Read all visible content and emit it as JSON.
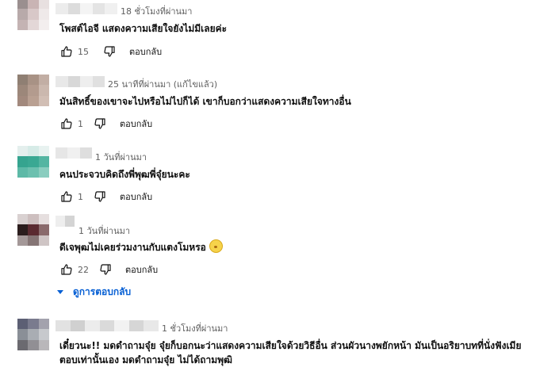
{
  "comments": [
    {
      "time": "18 ชั่วโมงที่ผ่านมา",
      "text": "โพสต์ไอจี แสดงความเสียใจยังไม่มีเลยค่ะ",
      "likes": "15",
      "reply_label": "ตอบกลับ",
      "avatar_colors": [
        "#9a8f8f",
        "#c9b4b4",
        "#e8e0e0",
        "#b8aaaa",
        "#d8c8c8",
        "#efe9e9",
        "#c4b3b3",
        "#e3d7d7",
        "#f3eeee"
      ],
      "name_colors": [
        "#ececec",
        "#dcdcdc",
        "#f4f4f4",
        "#e4e4e4",
        "#f0f0f0"
      ]
    },
    {
      "time": "25 นาทีที่ผ่านมา (แก้ไขแล้ว)",
      "text": "มันสิทธิ์ของเขาจะไปหรือไม่ไปก็ได้ เขาก็บอกว่าแสดงความเสียใจทางอื่น",
      "likes": "1",
      "reply_label": "ตอบกลับ",
      "avatar_colors": [
        "#8f7f73",
        "#a89285",
        "#c2aea4",
        "#9c877a",
        "#b39b8e",
        "#cbb8ae",
        "#a2897d",
        "#b9a092",
        "#d1beb4"
      ],
      "name_colors": [
        "#e8e8e8",
        "#d8d8d8",
        "#eeeeee",
        "#e0e0e0"
      ]
    },
    {
      "time": "1 วันที่ผ่านมา",
      "text": "คนประจวบคิดถึงพี่พุฒพี่จุ๋ยนะคะ",
      "likes": "1",
      "reply_label": "ตอบกลับ",
      "avatar_colors": [
        "#e4efed",
        "#d6ebe7",
        "#e8f2f0",
        "#35a48f",
        "#3aa893",
        "#54b5a2",
        "#5db9a7",
        "#6cc0af",
        "#8acdbf"
      ],
      "name_colors": [
        "#e6e6e6",
        "#f0f0f0",
        "#dedede"
      ]
    },
    {
      "time": "1 วันที่ผ่านมา",
      "text": "ดีเจพุฒไม่เคยร่วมงานกับแตงโมหรอ",
      "likes": "22",
      "reply_label": "ตอบกลับ",
      "avatar_colors": [
        "#d9d1d1",
        "#cdbfbf",
        "#e6dfdf",
        "#2b1d1d",
        "#5a2a30",
        "#8a6a6c",
        "#a49898",
        "#857575",
        "#cfc5c5"
      ],
      "name_colors": [
        "#eeeeee",
        "#d4d4d4"
      ]
    },
    {
      "time": "1 ชั่วโมงที่ผ่านมา",
      "text_lines": [
        "เดี๋ยวนะ!! มดดำถามจุ๋ย จุ๋ยก็บอกนะว่าแสดงความเสียใจด้วยวิธีอื่น ส่วนผัวนางพยักหน้า มันเป็นอริยาบทที่นั่งฟังเมีย",
        "ตอบเท่านั้นเอง มดดำถามจุ๋ย ไม่ได้ถามพุฒิ"
      ],
      "avatar_colors": [
        "#5c5f74",
        "#7a7b8e",
        "#a3a2ad",
        "#8a8f97",
        "#a9adb3",
        "#c7c9cd",
        "#6b6a70",
        "#918f94",
        "#b9b7ba"
      ],
      "name_colors": [
        "#e2e2e2",
        "#d0d0d0",
        "#ececec",
        "#dadada",
        "#f2f2f2",
        "#d6d6d6",
        "#e8e8e8"
      ]
    }
  ],
  "replies_toggle": {
    "label": "ดูการตอบกลับ",
    "color": "#065fd4"
  },
  "icons": {
    "like": "thumbs-up-icon",
    "dislike": "thumbs-down-icon",
    "emoji": "flushed-face-emoji-icon"
  }
}
